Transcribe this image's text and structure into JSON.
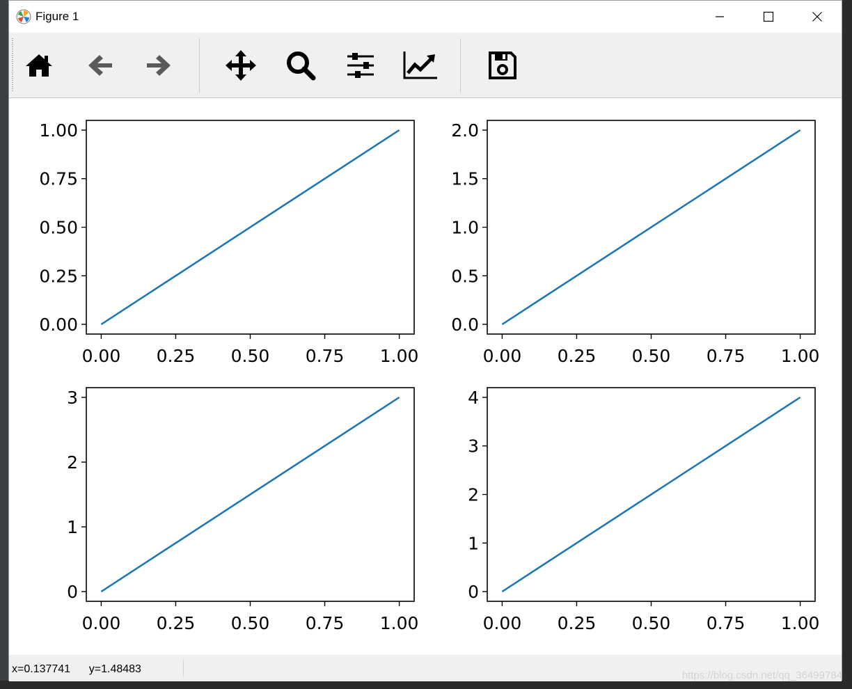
{
  "window": {
    "title": "Figure 1"
  },
  "toolbar": {
    "buttons": [
      {
        "name": "home-button",
        "icon": "home-icon"
      },
      {
        "name": "back-button",
        "icon": "arrow-left-icon"
      },
      {
        "name": "forward-button",
        "icon": "arrow-right-icon"
      },
      {
        "name": "pan-button",
        "icon": "move-icon"
      },
      {
        "name": "zoom-button",
        "icon": "magnifier-icon"
      },
      {
        "name": "subplots-button",
        "icon": "sliders-icon"
      },
      {
        "name": "edit-axis-button",
        "icon": "chart-line-icon"
      },
      {
        "name": "save-button",
        "icon": "floppy-disk-icon"
      }
    ]
  },
  "status": {
    "coords": "x=0.137741      y=1.48483"
  },
  "watermark": "https://blog.csdn.net/qq_36499784",
  "colors": {
    "line": "#1f77b4",
    "toolbar_bg": "#f0f0f0"
  },
  "chart_data": [
    {
      "type": "line",
      "x": [
        0,
        1
      ],
      "series": [
        {
          "values": [
            0,
            1
          ]
        }
      ],
      "xlim": [
        -0.05,
        1.05
      ],
      "ylim": [
        -0.05,
        1.05
      ],
      "xticks": [
        "0.00",
        "0.25",
        "0.50",
        "0.75",
        "1.00"
      ],
      "xtick_values": [
        0,
        0.25,
        0.5,
        0.75,
        1.0
      ],
      "yticks": [
        "0.00",
        "0.25",
        "0.50",
        "0.75",
        "1.00"
      ],
      "ytick_values": [
        0,
        0.25,
        0.5,
        0.75,
        1.0
      ]
    },
    {
      "type": "line",
      "x": [
        0,
        1
      ],
      "series": [
        {
          "values": [
            0,
            2
          ]
        }
      ],
      "xlim": [
        -0.05,
        1.05
      ],
      "ylim": [
        -0.1,
        2.1
      ],
      "xticks": [
        "0.00",
        "0.25",
        "0.50",
        "0.75",
        "1.00"
      ],
      "xtick_values": [
        0,
        0.25,
        0.5,
        0.75,
        1.0
      ],
      "yticks": [
        "0.0",
        "0.5",
        "1.0",
        "1.5",
        "2.0"
      ],
      "ytick_values": [
        0,
        0.5,
        1.0,
        1.5,
        2.0
      ]
    },
    {
      "type": "line",
      "x": [
        0,
        1
      ],
      "series": [
        {
          "values": [
            0,
            3
          ]
        }
      ],
      "xlim": [
        -0.05,
        1.05
      ],
      "ylim": [
        -0.15,
        3.15
      ],
      "xticks": [
        "0.00",
        "0.25",
        "0.50",
        "0.75",
        "1.00"
      ],
      "xtick_values": [
        0,
        0.25,
        0.5,
        0.75,
        1.0
      ],
      "yticks": [
        "0",
        "1",
        "2",
        "3"
      ],
      "ytick_values": [
        0,
        1,
        2,
        3
      ]
    },
    {
      "type": "line",
      "x": [
        0,
        1
      ],
      "series": [
        {
          "values": [
            0,
            4
          ]
        }
      ],
      "xlim": [
        -0.05,
        1.05
      ],
      "ylim": [
        -0.2,
        4.2
      ],
      "xticks": [
        "0.00",
        "0.25",
        "0.50",
        "0.75",
        "1.00"
      ],
      "xtick_values": [
        0,
        0.25,
        0.5,
        0.75,
        1.0
      ],
      "yticks": [
        "0",
        "1",
        "2",
        "3",
        "4"
      ],
      "ytick_values": [
        0,
        1,
        2,
        3,
        4
      ]
    }
  ]
}
